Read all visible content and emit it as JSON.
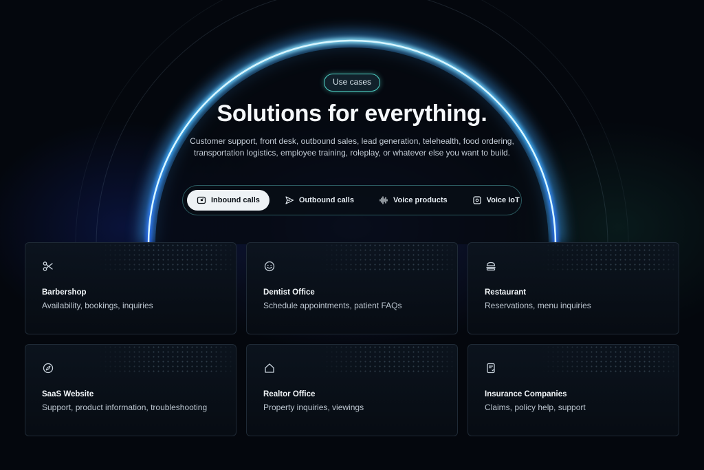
{
  "hero": {
    "badge": "Use cases",
    "title": "Solutions for everything.",
    "subtitle": "Customer support, front desk, outbound sales, lead generation, telehealth, food ordering, transportation logistics, employee training, roleplay, or whatever else you want to build."
  },
  "tabs": [
    {
      "label": "Inbound calls",
      "icon": "inbound-call-icon",
      "active": true
    },
    {
      "label": "Outbound calls",
      "icon": "send-icon",
      "active": false
    },
    {
      "label": "Voice products",
      "icon": "waveform-icon",
      "active": false
    },
    {
      "label": "Voice IoT",
      "icon": "device-icon",
      "active": false
    }
  ],
  "cards": [
    {
      "title": "Barbershop",
      "description": "Availability, bookings, inquiries",
      "icon": "scissors-icon"
    },
    {
      "title": "Dentist Office",
      "description": "Schedule appointments, patient FAQs",
      "icon": "smile-icon"
    },
    {
      "title": "Restaurant",
      "description": "Reservations, menu inquiries",
      "icon": "burger-icon"
    },
    {
      "title": "SaaS Website",
      "description": "Support, product information, troubleshooting",
      "icon": "compass-icon"
    },
    {
      "title": "Realtor Office",
      "description": "Property inquiries, viewings",
      "icon": "house-icon"
    },
    {
      "title": "Insurance Companies",
      "description": "Claims, policy help, support",
      "icon": "document-icon"
    }
  ],
  "colors": {
    "background": "#04070d",
    "ring_glow": "#5fd0ff",
    "badge_border": "#4fd1c5",
    "active_tab": "#eef2f5"
  }
}
